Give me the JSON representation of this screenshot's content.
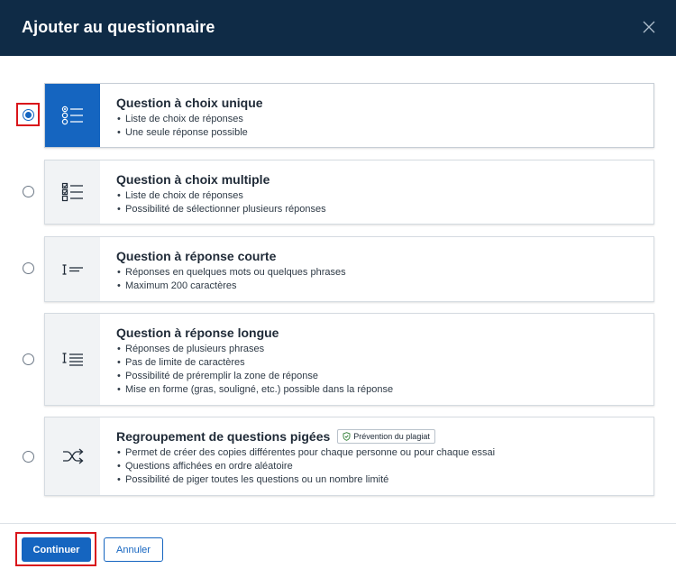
{
  "dialog": {
    "title": "Ajouter au questionnaire",
    "close_icon": "close-icon"
  },
  "options": [
    {
      "id": "single",
      "selected": true,
      "icon": "single-choice-list-icon",
      "title": "Question à choix unique",
      "bullets": [
        "Liste de choix de réponses",
        "Une seule réponse possible"
      ]
    },
    {
      "id": "multiple",
      "selected": false,
      "icon": "multiple-choice-list-icon",
      "title": "Question à choix multiple",
      "bullets": [
        "Liste de choix de réponses",
        "Possibilité de sélectionner plusieurs réponses"
      ]
    },
    {
      "id": "short",
      "selected": false,
      "icon": "short-answer-icon",
      "title": "Question à réponse courte",
      "bullets": [
        "Réponses en quelques mots ou quelques phrases",
        "Maximum 200 caractères"
      ]
    },
    {
      "id": "long",
      "selected": false,
      "icon": "long-answer-icon",
      "title": "Question à réponse longue",
      "bullets": [
        "Réponses de plusieurs phrases",
        "Pas de limite de caractères",
        "Possibilité de préremplir la zone de réponse",
        "Mise en forme (gras, souligné, etc.) possible dans la réponse"
      ]
    },
    {
      "id": "pool",
      "selected": false,
      "icon": "shuffle-icon",
      "title": "Regroupement de questions pigées",
      "badge": "Prévention du plagiat",
      "badge_icon": "shield-check-icon",
      "bullets": [
        "Permet de créer des copies différentes pour chaque personne ou pour chaque essai",
        "Questions affichées en ordre aléatoire",
        "Possibilité de piger toutes les questions ou un nombre limité"
      ]
    }
  ],
  "footer": {
    "continue_label": "Continuer",
    "cancel_label": "Annuler"
  },
  "colors": {
    "header_bg": "#0f2b46",
    "accent": "#1565c0",
    "highlight": "#d9151b"
  }
}
